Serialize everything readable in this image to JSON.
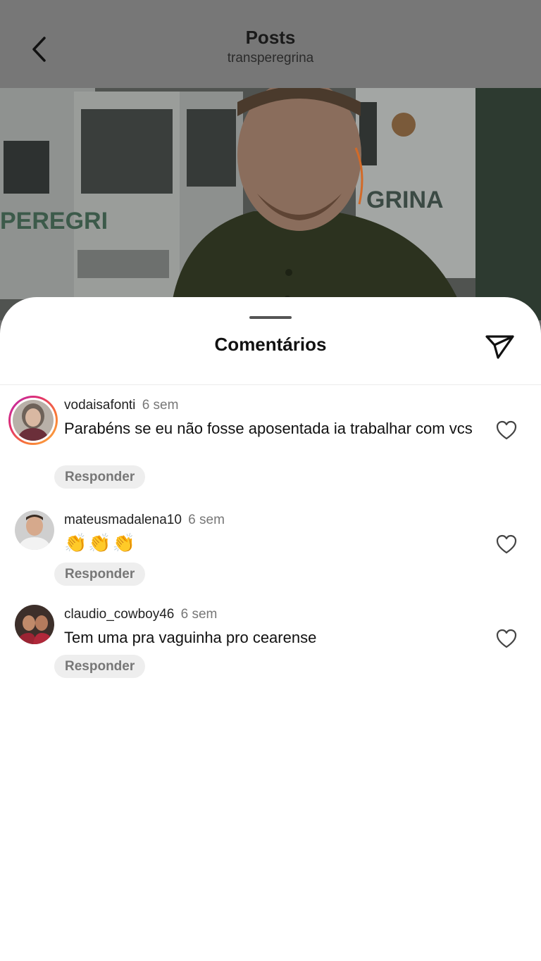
{
  "header": {
    "title": "Posts",
    "subtitle": "transperegrina"
  },
  "photo": {
    "truck_left_text": "PEREGRI",
    "truck_right_text": "GRINA"
  },
  "sheet": {
    "title": "Comentários"
  },
  "comments": [
    {
      "username": "vodaisafonti",
      "time": "6 sem",
      "text": "Parabéns se eu não fosse aposentada ia trabalhar com vcs",
      "reply_label": "Responder"
    },
    {
      "username": "mateusmadalena10",
      "time": "6 sem",
      "text": "👏👏👏",
      "reply_label": "Responder"
    },
    {
      "username": "claudio_cowboy46",
      "time": "6 sem",
      "text": "Tem uma pra vaguinha pro cearense",
      "reply_label": "Responder"
    }
  ],
  "icons": {
    "back": "chevron-left-icon",
    "share": "send-icon",
    "like": "heart-icon"
  },
  "colors": {
    "overlay": "#777777",
    "sheet": "#ffffff",
    "reply_bg": "#eeeeee"
  }
}
